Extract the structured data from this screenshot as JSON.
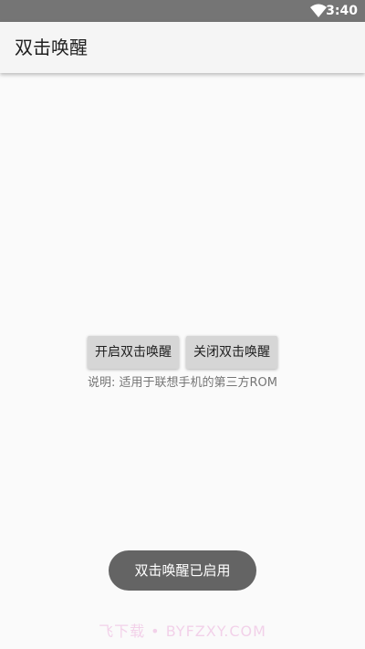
{
  "status_bar": {
    "time": "3:40",
    "wifi_icon": "wifi-icon"
  },
  "app_bar": {
    "title": "双击唤醒"
  },
  "main": {
    "enable_button": "开启双击唤醒",
    "disable_button": "关闭双击唤醒",
    "note": "说明: 适用于联想手机的第三方ROM"
  },
  "toast": {
    "message": "双击唤醒已启用"
  },
  "watermark": {
    "text": "飞下载 • BYFZXY.COM"
  },
  "colors": {
    "status_bar": "#757575",
    "app_bar": "#f5f5f5",
    "background": "#fafafa",
    "button": "#d6d6d6",
    "toast": "#646464"
  }
}
